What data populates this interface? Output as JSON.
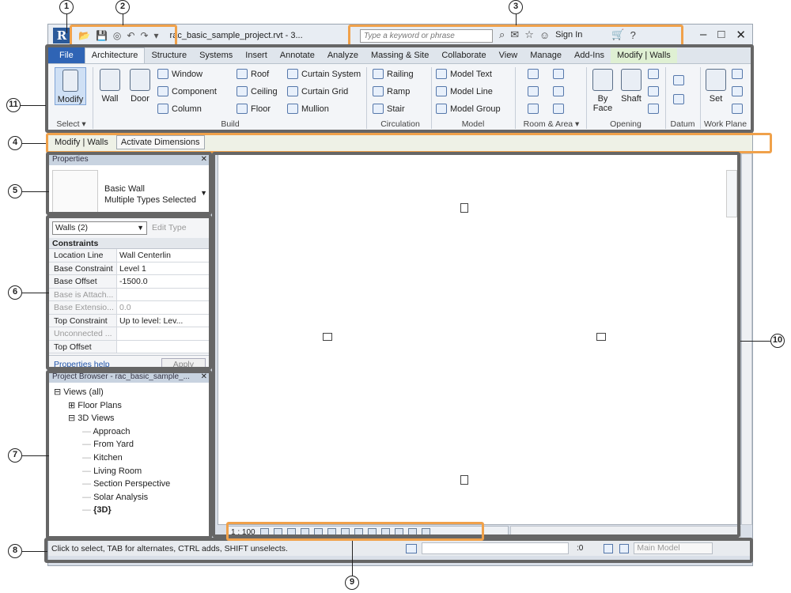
{
  "window": {
    "title": "rac_basic_sample_project.rvt - 3...",
    "search_placeholder": "Type a keyword or phrase",
    "signin_label": "Sign In"
  },
  "ribbon_tabs": [
    "File",
    "Architecture",
    "Structure",
    "Systems",
    "Insert",
    "Annotate",
    "Analyze",
    "Massing & Site",
    "Collaborate",
    "View",
    "Manage",
    "Add-Ins",
    "Modify | Walls"
  ],
  "ribbon": {
    "modify_label": "Modify",
    "select_label": "Select ▾",
    "wall_label": "Wall",
    "door_label": "Door",
    "window_label": "Window",
    "component_label": "Component",
    "column_label": "Column",
    "roof_label": "Roof",
    "ceiling_label": "Ceiling",
    "floor_label": "Floor",
    "curtain_system_label": "Curtain System",
    "curtain_grid_label": "Curtain Grid",
    "mullion_label": "Mullion",
    "build_label": "Build",
    "railing_label": "Railing",
    "ramp_label": "Ramp",
    "stair_label": "Stair",
    "circulation_label": "Circulation",
    "model_text_label": "Model Text",
    "model_line_label": "Model Line",
    "model_group_label": "Model Group",
    "model_label": "Model",
    "room_area_label": "Room & Area ▾",
    "by_face_label": "By Face",
    "shaft_label": "Shaft",
    "opening_label": "Opening",
    "datum_label": "Datum",
    "set_label": "Set",
    "work_plane_label": "Work Plane"
  },
  "options_bar": {
    "context_label": "Modify | Walls",
    "activate_dimensions_label": "Activate Dimensions"
  },
  "properties": {
    "header": "Properties",
    "type_name": "Basic Wall",
    "type_sub": "Multiple Types Selected",
    "filter_value": "Walls (2)",
    "edit_type_label": "Edit Type",
    "section_label": "Constraints",
    "rows": [
      {
        "k": "Location Line",
        "v": "Wall Centerlin"
      },
      {
        "k": "Base Constraint",
        "v": "Level 1"
      },
      {
        "k": "Base Offset",
        "v": "-1500.0"
      },
      {
        "k": "Base is Attach...",
        "v": ""
      },
      {
        "k": "Base Extensio...",
        "v": "0.0"
      },
      {
        "k": "Top Constraint",
        "v": "Up to level: Lev..."
      },
      {
        "k": "Unconnected ...",
        "v": ""
      },
      {
        "k": "Top Offset",
        "v": ""
      }
    ],
    "help_label": "Properties help",
    "apply_label": "Apply"
  },
  "project_browser": {
    "header": "Project Browser - rac_basic_sample_...",
    "items": [
      {
        "label": "Views (all)",
        "level": 0,
        "toggle": "⊟"
      },
      {
        "label": "Floor Plans",
        "level": 1,
        "toggle": "⊞"
      },
      {
        "label": "3D Views",
        "level": 1,
        "toggle": "⊟"
      },
      {
        "label": "Approach",
        "level": 2,
        "toggle": ""
      },
      {
        "label": "From Yard",
        "level": 2,
        "toggle": ""
      },
      {
        "label": "Kitchen",
        "level": 2,
        "toggle": ""
      },
      {
        "label": "Living Room",
        "level": 2,
        "toggle": ""
      },
      {
        "label": "Section Perspective",
        "level": 2,
        "toggle": ""
      },
      {
        "label": "Solar Analysis",
        "level": 2,
        "toggle": ""
      },
      {
        "label": "{3D}",
        "level": 2,
        "toggle": "",
        "bold": true
      }
    ]
  },
  "view_control": {
    "scale": "1 : 100"
  },
  "status_bar": {
    "message": "Click to select, TAB for alternates, CTRL adds, SHIFT unselects.",
    "count": ":0",
    "model_label": "Main Model"
  },
  "callouts": [
    "1",
    "2",
    "3",
    "4",
    "5",
    "6",
    "7",
    "8",
    "9",
    "10",
    "11"
  ],
  "colors": {
    "orange_highlight": "#f0a14a",
    "gray_highlight": "#666666",
    "file_tab": "#2f64b5"
  }
}
